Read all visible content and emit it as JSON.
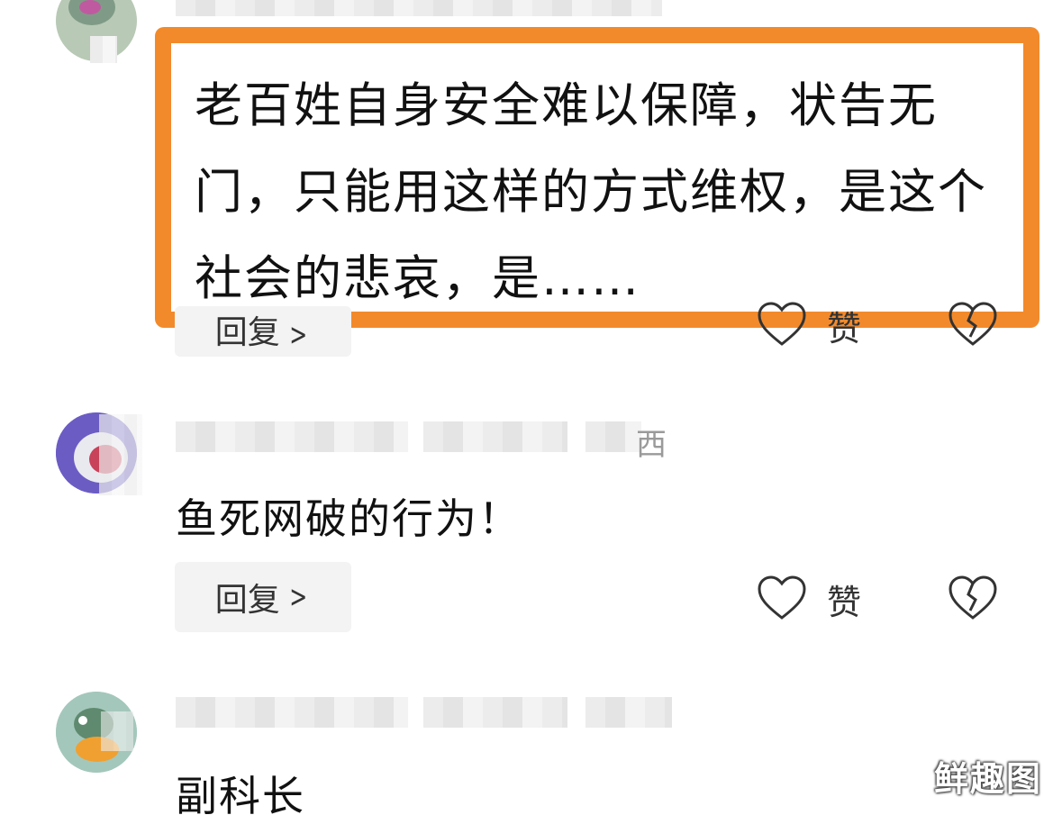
{
  "comments": [
    {
      "text": "老百姓自身安全难以保障，状告无门，只能用这样的方式维权，是这个社会的悲哀，是……",
      "reply_label": "回复",
      "like_label": "赞"
    },
    {
      "name_suffix": "西",
      "text": "鱼死网破的行为！",
      "reply_label": "回复",
      "like_label": "赞"
    },
    {
      "text": "副科长"
    }
  ],
  "watermark": "鲜趣图",
  "colors": {
    "highlight_border": "#f28a2c",
    "reply_bg": "#f3f3f3"
  }
}
